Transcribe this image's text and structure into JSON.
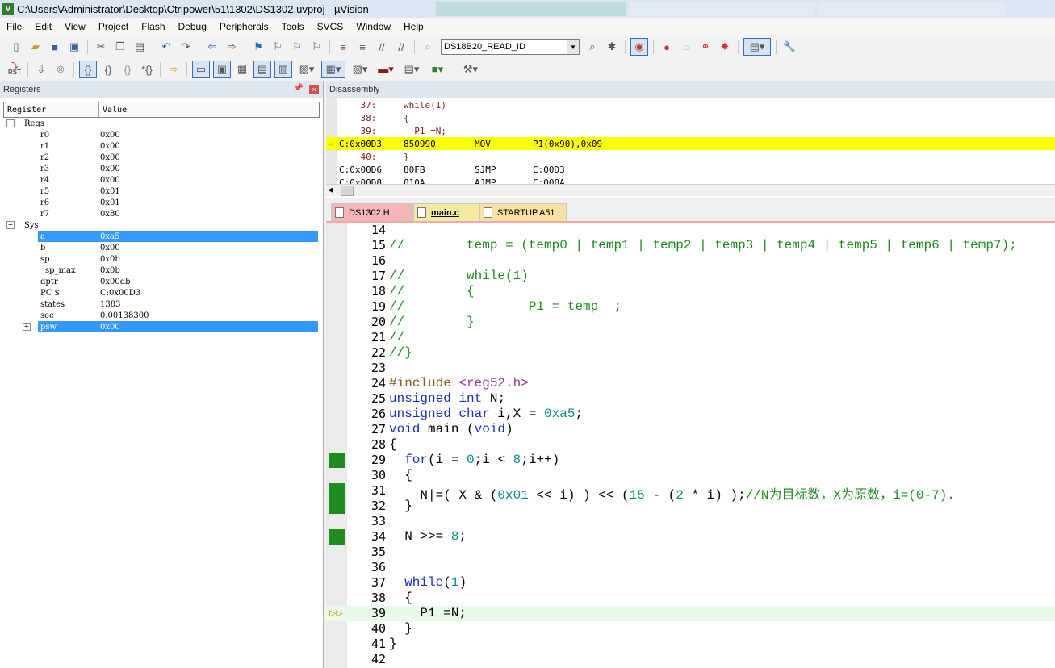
{
  "window": {
    "title": "C:\\Users\\Administrator\\Desktop\\Ctrlpower\\51\\1302\\DS1302.uvproj - µVision"
  },
  "menu": [
    "File",
    "Edit",
    "View",
    "Project",
    "Flash",
    "Debug",
    "Peripherals",
    "Tools",
    "SVCS",
    "Window",
    "Help"
  ],
  "toolbar": {
    "target_combo": "DS18B20_READ_ID",
    "rst_label": "RST"
  },
  "registers": {
    "panel_title": "Registers",
    "col_register": "Register",
    "col_value": "Value",
    "rows": [
      {
        "name": "Regs",
        "value": "",
        "indent": 0,
        "expander": "-"
      },
      {
        "name": "r0",
        "value": "0x00",
        "indent": 2
      },
      {
        "name": "r1",
        "value": "0x00",
        "indent": 2
      },
      {
        "name": "r2",
        "value": "0x00",
        "indent": 2
      },
      {
        "name": "r3",
        "value": "0x00",
        "indent": 2
      },
      {
        "name": "r4",
        "value": "0x00",
        "indent": 2
      },
      {
        "name": "r5",
        "value": "0x01",
        "indent": 2
      },
      {
        "name": "r6",
        "value": "0x01",
        "indent": 2
      },
      {
        "name": "r7",
        "value": "0x80",
        "indent": 2
      },
      {
        "name": "Sys",
        "value": "",
        "indent": 0,
        "expander": "-"
      },
      {
        "name": "a",
        "value": "0xa5",
        "indent": 2,
        "selected": true
      },
      {
        "name": "b",
        "value": "0x00",
        "indent": 2
      },
      {
        "name": "sp",
        "value": "0x0b",
        "indent": 2
      },
      {
        "name": "sp_max",
        "value": "0x0b",
        "indent": 3
      },
      {
        "name": "dptr",
        "value": "0x00db",
        "indent": 2
      },
      {
        "name": "PC  $",
        "value": "C:0x00D3",
        "indent": 2
      },
      {
        "name": "states",
        "value": "1383",
        "indent": 2
      },
      {
        "name": "sec",
        "value": "0.00138300",
        "indent": 2
      },
      {
        "name": "psw",
        "value": "0x00",
        "indent": 2,
        "selected": true,
        "expander": "+"
      }
    ]
  },
  "disassembly": {
    "panel_title": "Disassembly",
    "rows": [
      {
        "a": "    37:",
        "b": "while(1)",
        "c": "",
        "d": "",
        "hl": false
      },
      {
        "a": "    38:",
        "b": "{",
        "c": "",
        "d": "",
        "hl": false
      },
      {
        "a": "    39:",
        "b": "  P1 =N;",
        "c": "",
        "d": "",
        "hl": false
      },
      {
        "a": "C:0x00D3",
        "b": "850990",
        "c": "MOV",
        "d": "P1(0x90),0x09",
        "hl": true
      },
      {
        "a": "    40:",
        "b": "}",
        "c": "",
        "d": "",
        "hl": false
      },
      {
        "a": "C:0x00D6",
        "b": "80FB",
        "c": "SJMP",
        "d": "C:00D3",
        "hl": false
      },
      {
        "a": "C:0x00D8",
        "b": "010A",
        "c": "AJMP",
        "d": "C:000A",
        "hl": false
      }
    ]
  },
  "tabs": [
    "DS1302.H",
    "main.c",
    "STARTUP.A51"
  ],
  "editor": {
    "lines": [
      {
        "n": "14",
        "t": ""
      },
      {
        "n": "15",
        "t": "//        temp = (temp0 | temp1 | temp2 | temp3 | temp4 | temp5 | temp6 | temp7);"
      },
      {
        "n": "16",
        "t": ""
      },
      {
        "n": "17",
        "t": "//        while(1)"
      },
      {
        "n": "18",
        "t": "//        {"
      },
      {
        "n": "19",
        "t": "//                P1 = temp  ;"
      },
      {
        "n": "20",
        "t": "//        }"
      },
      {
        "n": "21",
        "t": "//"
      },
      {
        "n": "22",
        "t": "//}"
      },
      {
        "n": "23",
        "t": ""
      },
      {
        "n": "24",
        "t": "#include <reg52.h>"
      },
      {
        "n": "25",
        "t": "unsigned int N;"
      },
      {
        "n": "26",
        "t": "unsigned char i,X = 0xa5;"
      },
      {
        "n": "27",
        "t": "void main (void)"
      },
      {
        "n": "28",
        "t": "{"
      },
      {
        "n": "29",
        "t": "  for(i = 0;i < 8;i++)"
      },
      {
        "n": "30",
        "t": "  {"
      },
      {
        "n": "31",
        "t": "    N|=( X & (0x01 << i) ) << (15 - (2 * i) );//N为目标数，X为原数，i=(0-7)."
      },
      {
        "n": "32",
        "t": "  }"
      },
      {
        "n": "33",
        "t": ""
      },
      {
        "n": "34",
        "t": "  N >>= 8;"
      },
      {
        "n": "35",
        "t": ""
      },
      {
        "n": "36",
        "t": ""
      },
      {
        "n": "37",
        "t": "  while(1)"
      },
      {
        "n": "38",
        "t": "  {"
      },
      {
        "n": "39",
        "t": "    P1 =N;"
      },
      {
        "n": "40",
        "t": "  }"
      },
      {
        "n": "41",
        "t": "}"
      },
      {
        "n": "42",
        "t": ""
      }
    ]
  }
}
